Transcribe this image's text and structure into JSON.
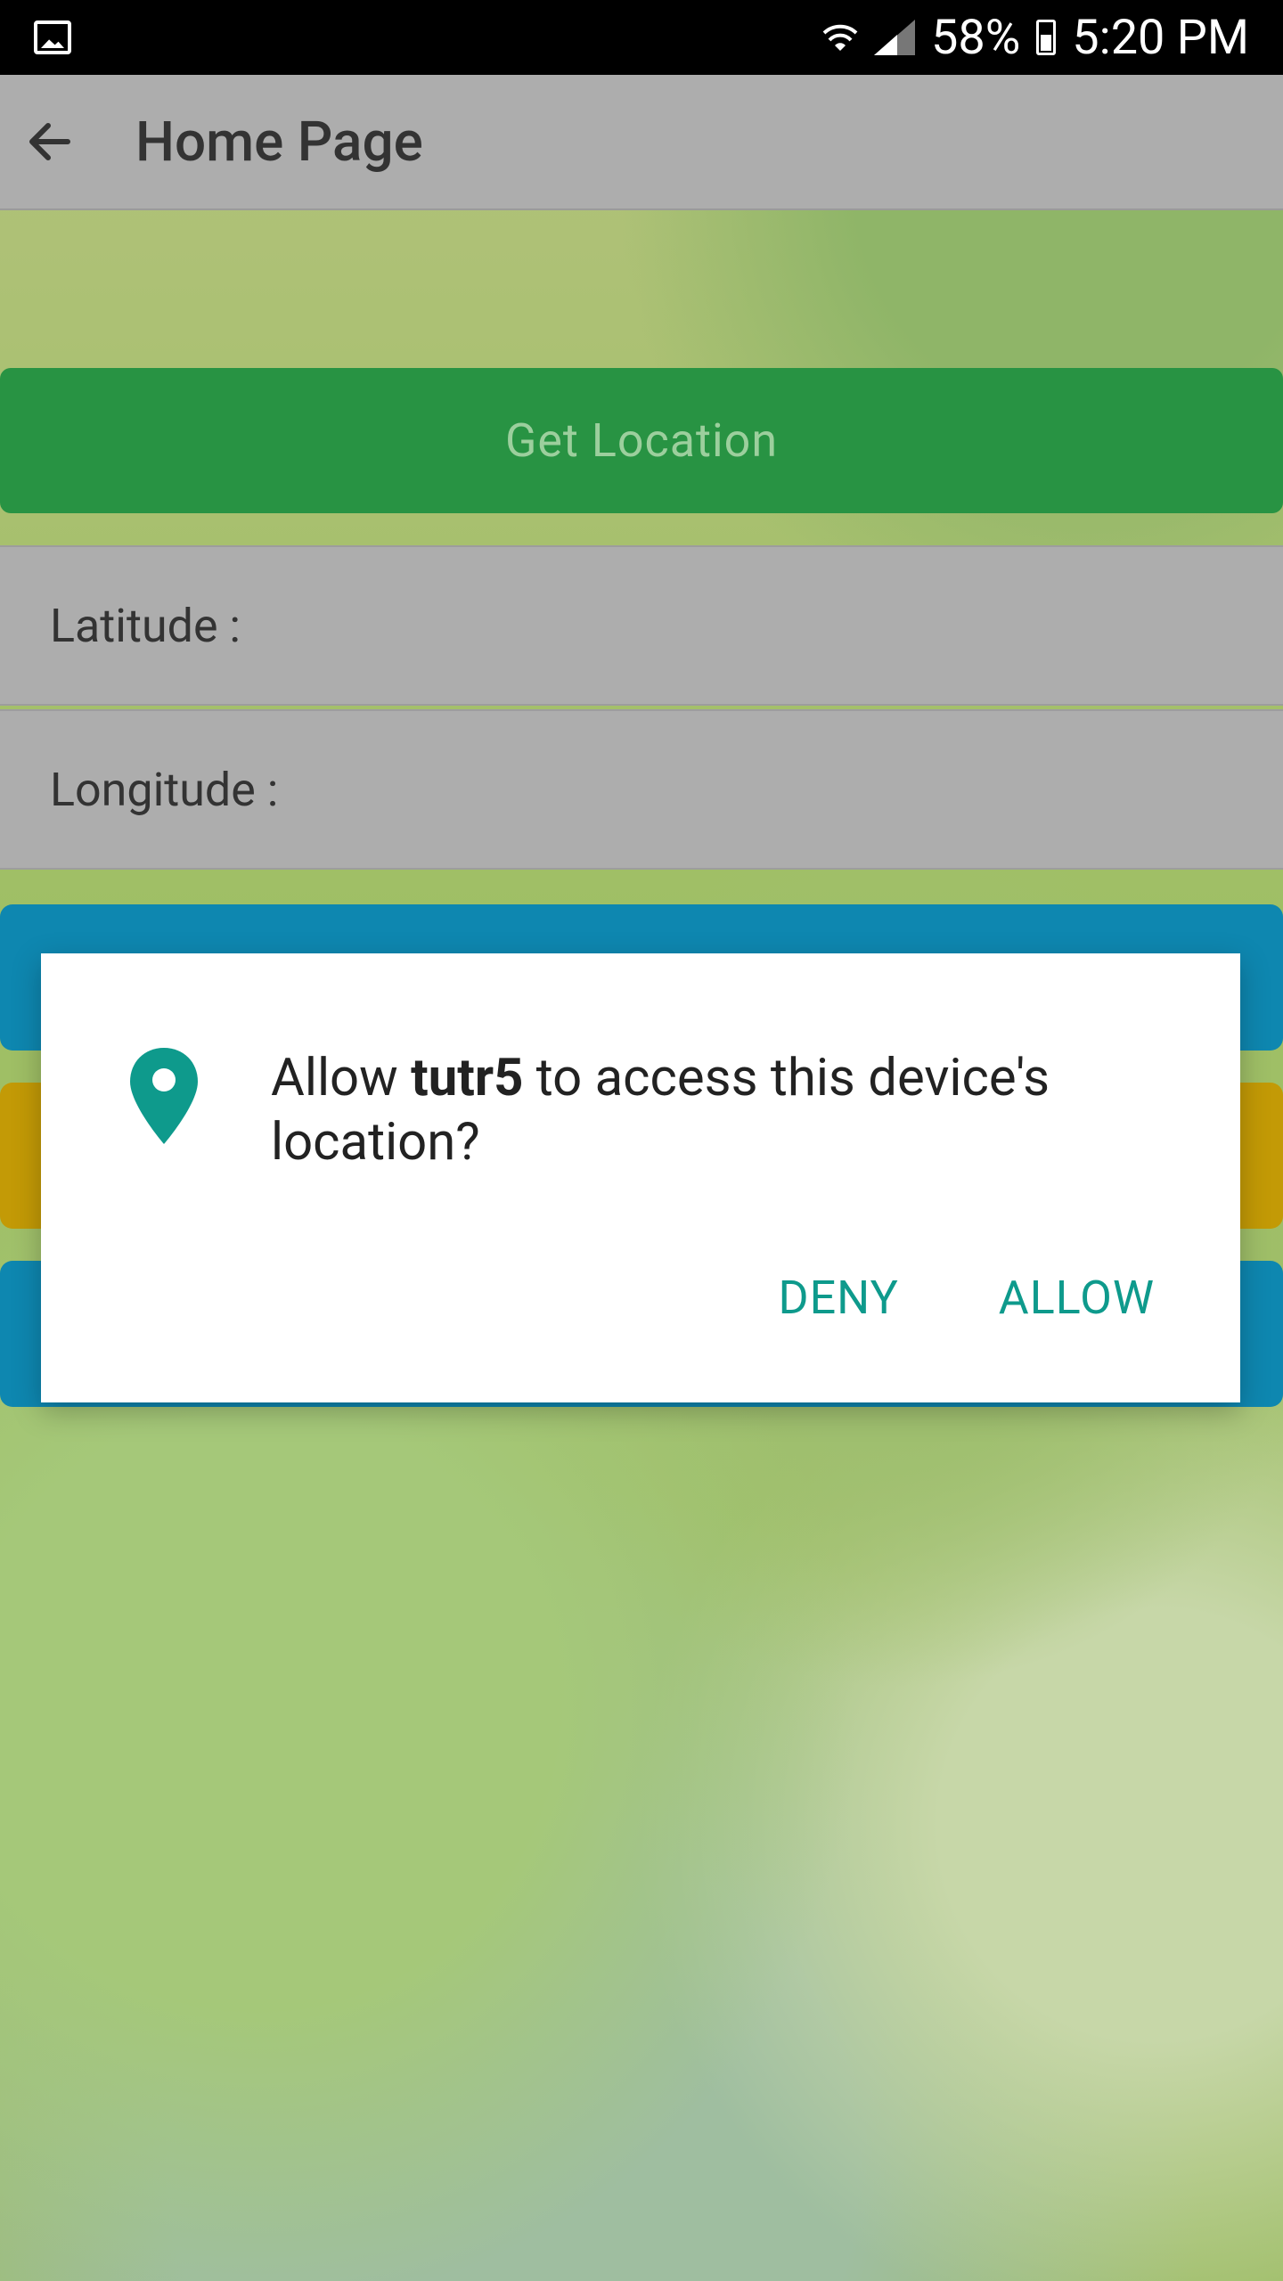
{
  "status_bar": {
    "battery": "58%",
    "time": "5:20 PM"
  },
  "app_bar": {
    "title": "Home Page"
  },
  "main": {
    "get_location_label": "Get Location",
    "latitude_label": "Latitude :",
    "longitude_label": "Longitude :"
  },
  "dialog": {
    "prefix": "Allow ",
    "app_name": "tutr5",
    "suffix": " to access this device's location?",
    "deny_label": "DENY",
    "allow_label": "ALLOW"
  },
  "colors": {
    "primary_button": "#289343",
    "accent_blue": "#0e87b0",
    "accent_yellow": "#c39a06",
    "dialog_action": "#0e9a8c",
    "location_pin": "#0e9a8c"
  }
}
